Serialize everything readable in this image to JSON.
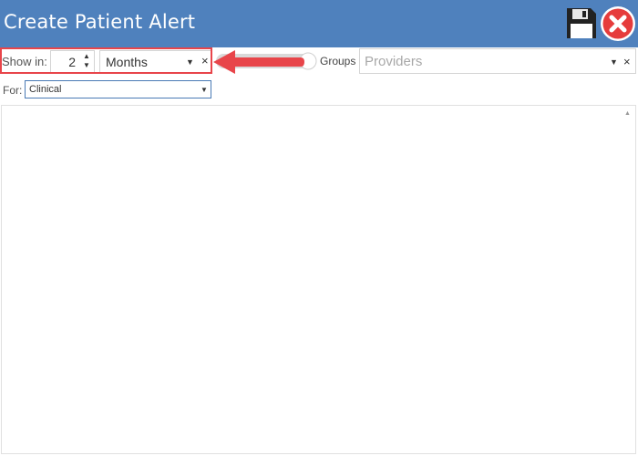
{
  "header": {
    "title": "Create Patient Alert",
    "save_icon": "floppy-disk-icon",
    "close_icon": "red-circle-x-icon",
    "bar_color": "#4f81bd"
  },
  "toolbar": {
    "show_in_label": "Show in:",
    "show_in_value": "2",
    "unit_value": "Months",
    "groups_label": "Groups",
    "providers_placeholder": "Providers",
    "clear_glyph": "×",
    "dropdown_glyph": "▼",
    "highlight_color": "#e8454a"
  },
  "filter": {
    "for_label": "For:",
    "for_value": "Clinical"
  },
  "body": {
    "alert_text": ""
  }
}
